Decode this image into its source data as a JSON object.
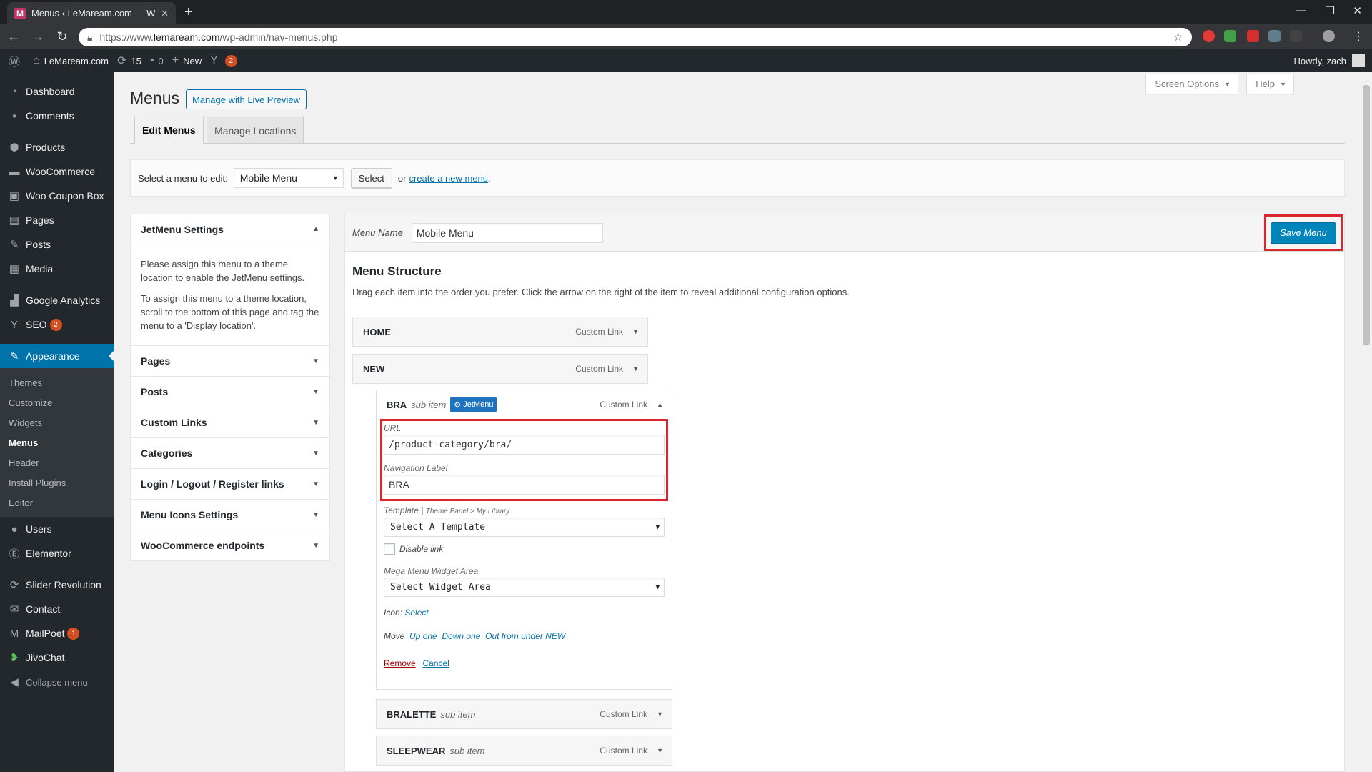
{
  "browser": {
    "tab_title": "Menus ‹ LeMaream.com — Word",
    "url_prefix": "https://www.",
    "url_domain": "lemaream.com",
    "url_path": "/wp-admin/nav-menus.php"
  },
  "adminbar": {
    "site": "LeMaream.com",
    "updates": "15",
    "comments": "0",
    "new": "New",
    "yoast_badge": "2",
    "howdy": "Howdy, zach"
  },
  "sidebar": {
    "items": [
      {
        "label": "Dashboard",
        "icon": "dashboard-icon"
      },
      {
        "label": "Comments",
        "icon": "comments-icon"
      },
      {
        "label": "Products",
        "icon": "products-icon"
      },
      {
        "label": "WooCommerce",
        "icon": "woocommerce-icon"
      },
      {
        "label": "Woo Coupon Box",
        "icon": "coupon-icon"
      },
      {
        "label": "Pages",
        "icon": "pages-icon"
      },
      {
        "label": "Posts",
        "icon": "posts-icon"
      },
      {
        "label": "Media",
        "icon": "media-icon"
      },
      {
        "label": "Google Analytics",
        "icon": "analytics-icon"
      },
      {
        "label": "SEO",
        "icon": "seo-icon",
        "badge": "2"
      },
      {
        "label": "Appearance",
        "icon": "appearance-icon"
      }
    ],
    "submenu": [
      "Themes",
      "Customize",
      "Widgets",
      "Menus",
      "Header",
      "Install Plugins",
      "Editor"
    ],
    "items2": [
      {
        "label": "Users",
        "icon": "users-icon"
      },
      {
        "label": "Elementor",
        "icon": "elementor-icon"
      },
      {
        "label": "Slider Revolution",
        "icon": "slider-icon"
      },
      {
        "label": "Contact",
        "icon": "contact-icon"
      },
      {
        "label": "MailPoet",
        "icon": "mailpoet-icon",
        "badge": "1"
      },
      {
        "label": "JivoChat",
        "icon": "jivochat-icon"
      },
      {
        "label": "Collapse menu",
        "icon": "collapse-icon"
      }
    ]
  },
  "header": {
    "screen_options": "Screen Options",
    "help": "Help",
    "title": "Menus",
    "live_preview": "Manage with Live Preview",
    "tabs": [
      "Edit Menus",
      "Manage Locations"
    ]
  },
  "select_menu": {
    "label": "Select a menu to edit:",
    "value": "Mobile Menu",
    "button": "Select",
    "or": "or",
    "create_link": "create a new menu",
    "period": "."
  },
  "left_panel": {
    "jetmenu_title": "JetMenu Settings",
    "jetmenu_p1": "Please assign this menu to a theme location to enable the JetMenu settings.",
    "jetmenu_p2": "To assign this menu to a theme location, scroll to the bottom of this page and tag the menu to a 'Display location'.",
    "sections": [
      "Pages",
      "Posts",
      "Custom Links",
      "Categories",
      "Login / Logout / Register links",
      "Menu Icons Settings",
      "WooCommerce endpoints"
    ]
  },
  "menu_edit": {
    "name_label": "Menu Name",
    "name_value": "Mobile Menu",
    "save": "Save Menu",
    "structure_title": "Menu Structure",
    "structure_desc": "Drag each item into the order you prefer. Click the arrow on the right of the item to reveal additional configuration options.",
    "items": [
      {
        "title": "HOME",
        "type": "Custom Link"
      },
      {
        "title": "NEW",
        "type": "Custom Link"
      },
      {
        "title": "BRA",
        "sub": "sub item",
        "type": "Custom Link",
        "badge": "JetMenu"
      },
      {
        "title": "BRALETTE",
        "sub": "sub item",
        "type": "Custom Link"
      },
      {
        "title": "SLEEPWEAR",
        "sub": "sub item",
        "type": "Custom Link"
      }
    ],
    "settings": {
      "url_label": "URL",
      "url_value": "/product-category/bra/",
      "nav_label": "Navigation Label",
      "nav_value": "BRA",
      "template_label": "Template",
      "template_links": "Theme Panel > My Library",
      "template_value": "Select A Template",
      "disable_link": "Disable link",
      "widget_label": "Mega Menu Widget Area",
      "widget_value": "Select Widget Area",
      "icon_label": "Icon:",
      "icon_select": "Select",
      "move_label": "Move",
      "move_up": "Up one",
      "move_down": "Down one",
      "move_out": "Out from under NEW",
      "remove": "Remove",
      "cancel": "Cancel"
    }
  }
}
